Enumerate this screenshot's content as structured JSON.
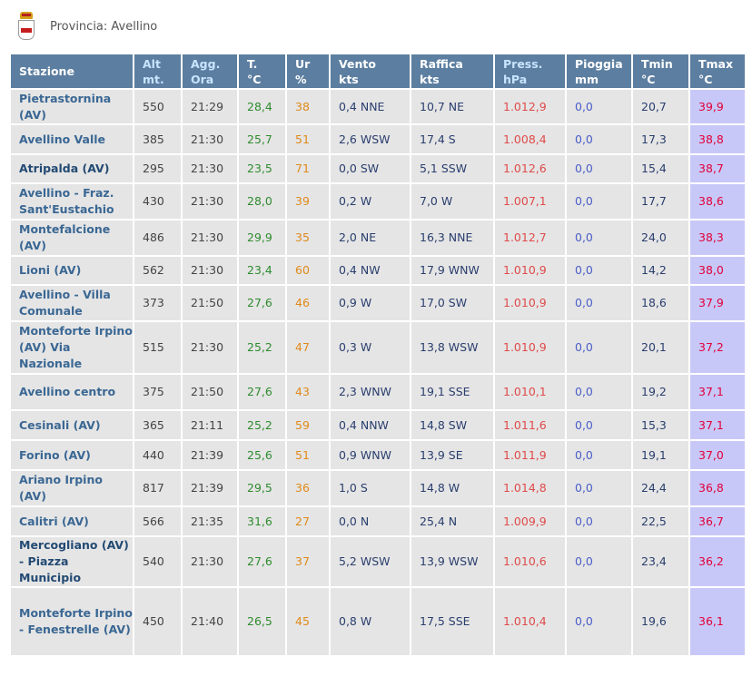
{
  "header": {
    "province_label": "Provincia: Avellino",
    "crest_icon": "province-crest-icon"
  },
  "table": {
    "headers": [
      {
        "line1": "Stazione",
        "line2": ""
      },
      {
        "line1": "Alt",
        "line2": "mt."
      },
      {
        "line1": "Agg.",
        "line2": "Ora"
      },
      {
        "line1": "T.",
        "line2": "°C"
      },
      {
        "line1": "Ur",
        "line2": "%"
      },
      {
        "line1": "Vento",
        "line2": "kts"
      },
      {
        "line1": "Raffica",
        "line2": "kts"
      },
      {
        "line1": "Press.",
        "line2": "hPa"
      },
      {
        "line1": "Pioggia",
        "line2": "mm"
      },
      {
        "line1": "Tmin",
        "line2": "°C"
      },
      {
        "line1": "Tmax",
        "line2": "°C"
      }
    ],
    "rows": [
      {
        "name": "Pietrastornina (AV)",
        "alt": "550",
        "ora": "21:29",
        "t": "28,4",
        "ur": "38",
        "vento": "0,4 NNE",
        "raffica": "10,7 NE",
        "press": "1.012,9",
        "pioggia": "0,0",
        "tmin": "20,7",
        "tmax": "39,9"
      },
      {
        "name": "Avellino Valle",
        "alt": "385",
        "ora": "21:30",
        "t": "25,7",
        "ur": "51",
        "vento": "2,6 WSW",
        "raffica": "17,4 S",
        "press": "1.008,4",
        "pioggia": "0,0",
        "tmin": "17,3",
        "tmax": "38,8"
      },
      {
        "name": "Atripalda (AV)",
        "alt": "295",
        "ora": "21:30",
        "t": "23,5",
        "ur": "71",
        "vento": "0,0 SW",
        "raffica": "5,1 SSW",
        "press": "1.012,6",
        "pioggia": "0,0",
        "tmin": "15,4",
        "tmax": "38,7"
      },
      {
        "name": "Avellino - Fraz. Sant'Eustachio",
        "alt": "430",
        "ora": "21:30",
        "t": "28,0",
        "ur": "39",
        "vento": "0,2 W",
        "raffica": "7,0 W",
        "press": "1.007,1",
        "pioggia": "0,0",
        "tmin": "17,7",
        "tmax": "38,6"
      },
      {
        "name": "Montefalcione (AV)",
        "alt": "486",
        "ora": "21:30",
        "t": "29,9",
        "ur": "35",
        "vento": "2,0 NE",
        "raffica": "16,3 NNE",
        "press": "1.012,7",
        "pioggia": "0,0",
        "tmin": "24,0",
        "tmax": "38,3"
      },
      {
        "name": "Lioni (AV)",
        "alt": "562",
        "ora": "21:30",
        "t": "23,4",
        "ur": "60",
        "vento": "0,4 NW",
        "raffica": "17,9 WNW",
        "press": "1.010,9",
        "pioggia": "0,0",
        "tmin": "14,2",
        "tmax": "38,0"
      },
      {
        "name": "Avellino - Villa Comunale",
        "alt": "373",
        "ora": "21:50",
        "t": "27,6",
        "ur": "46",
        "vento": "0,9 W",
        "raffica": "17,0 SW",
        "press": "1.010,9",
        "pioggia": "0,0",
        "tmin": "18,6",
        "tmax": "37,9"
      },
      {
        "name": "Monteforte Irpino (AV) Via Nazionale",
        "alt": "515",
        "ora": "21:30",
        "t": "25,2",
        "ur": "47",
        "vento": "0,3 W",
        "raffica": "13,8 WSW",
        "press": "1.010,9",
        "pioggia": "0,0",
        "tmin": "20,1",
        "tmax": "37,2"
      },
      {
        "name": "Avellino centro",
        "alt": "375",
        "ora": "21:50",
        "t": "27,6",
        "ur": "43",
        "vento": "2,3 WNW",
        "raffica": "19,1 SSE",
        "press": "1.010,1",
        "pioggia": "0,0",
        "tmin": "19,2",
        "tmax": "37,1"
      },
      {
        "name": "Cesinali (AV)",
        "alt": "365",
        "ora": "21:11",
        "t": "25,2",
        "ur": "59",
        "vento": "0,4 NNW",
        "raffica": "14,8 SW",
        "press": "1.011,6",
        "pioggia": "0,0",
        "tmin": "15,3",
        "tmax": "37,1"
      },
      {
        "name": "Forino (AV)",
        "alt": "440",
        "ora": "21:39",
        "t": "25,6",
        "ur": "51",
        "vento": "0,9 WNW",
        "raffica": "13,9 SE",
        "press": "1.011,9",
        "pioggia": "0,0",
        "tmin": "19,1",
        "tmax": "37,0"
      },
      {
        "name": "Ariano Irpino (AV)",
        "alt": "817",
        "ora": "21:39",
        "t": "29,5",
        "ur": "36",
        "vento": "1,0 S",
        "raffica": "14,8 W",
        "press": "1.014,8",
        "pioggia": "0,0",
        "tmin": "24,4",
        "tmax": "36,8"
      },
      {
        "name": "Calitri (AV)",
        "alt": "566",
        "ora": "21:35",
        "t": "31,6",
        "ur": "27",
        "vento": "0,0 N",
        "raffica": "25,4 N",
        "press": "1.009,9",
        "pioggia": "0,0",
        "tmin": "22,5",
        "tmax": "36,7"
      },
      {
        "name": "Mercogliano (AV) - Piazza Municipio",
        "alt": "540",
        "ora": "21:30",
        "t": "27,6",
        "ur": "37",
        "vento": "5,2 WSW",
        "raffica": "13,9 WSW",
        "press": "1.010,6",
        "pioggia": "0,0",
        "tmin": "23,4",
        "tmax": "36,2"
      },
      {
        "name": "Monteforte Irpino - Fenestrelle (AV)",
        "alt": "450",
        "ora": "21:40",
        "t": "26,5",
        "ur": "45",
        "vento": "0,8 W",
        "raffica": "17,5 SSE",
        "press": "1.010,4",
        "pioggia": "0,0",
        "tmin": "19,6",
        "tmax": "36,1"
      }
    ]
  }
}
